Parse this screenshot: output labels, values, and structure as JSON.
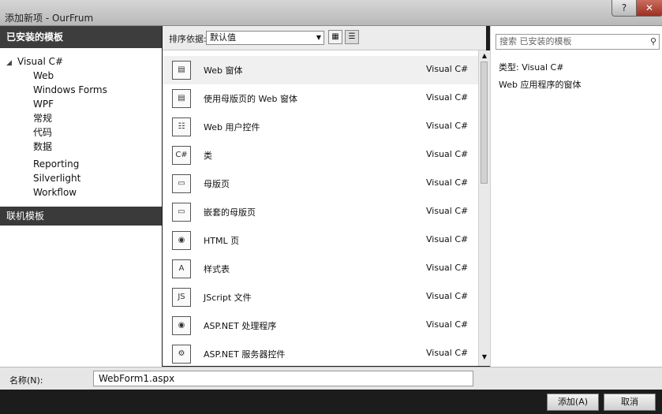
{
  "window": {
    "title": "添加新项 - OurFrum"
  },
  "title_buttons": {
    "help": "?",
    "close": "✕"
  },
  "left_panel": {
    "header": "已安装的模板",
    "tree": {
      "root": "Visual C#",
      "children": [
        "Web",
        "Windows Forms",
        "WPF",
        "常规",
        "代码",
        "数据",
        "Reporting",
        "Silverlight",
        "Workflow"
      ]
    },
    "online": "联机模板"
  },
  "toolbar": {
    "sort_label": "排序依据:",
    "sort_value": "默认值"
  },
  "templates": [
    {
      "name": "Web 窗体",
      "lang": "Visual C#",
      "icon": "web-form-icon",
      "selected": true
    },
    {
      "name": "使用母版页的 Web 窗体",
      "lang": "Visual C#",
      "icon": "web-form-master-icon",
      "selected": false
    },
    {
      "name": "Web 用户控件",
      "lang": "Visual C#",
      "icon": "user-control-icon",
      "selected": false
    },
    {
      "name": "类",
      "lang": "Visual C#",
      "icon": "class-icon",
      "selected": false
    },
    {
      "name": "母版页",
      "lang": "Visual C#",
      "icon": "master-page-icon",
      "selected": false
    },
    {
      "name": "嵌套的母版页",
      "lang": "Visual C#",
      "icon": "nested-master-icon",
      "selected": false
    },
    {
      "name": "HTML 页",
      "lang": "Visual C#",
      "icon": "html-page-icon",
      "selected": false
    },
    {
      "name": "样式表",
      "lang": "Visual C#",
      "icon": "stylesheet-icon",
      "selected": false
    },
    {
      "name": "JScript 文件",
      "lang": "Visual C#",
      "icon": "jscript-icon",
      "selected": false
    },
    {
      "name": "ASP.NET 处理程序",
      "lang": "Visual C#",
      "icon": "handler-icon",
      "selected": false
    },
    {
      "name": "ASP.NET 服务器控件",
      "lang": "Visual C#",
      "icon": "server-control-icon",
      "selected": false
    }
  ],
  "right_panel": {
    "search_placeholder": "搜索 已安装的模板",
    "type_line": "类型: Visual C#",
    "description": "Web 应用程序的窗体"
  },
  "name_field": {
    "label": "名称(N):",
    "value": "WebForm1.aspx"
  },
  "buttons": {
    "add": "添加(A)",
    "cancel": "取消"
  }
}
